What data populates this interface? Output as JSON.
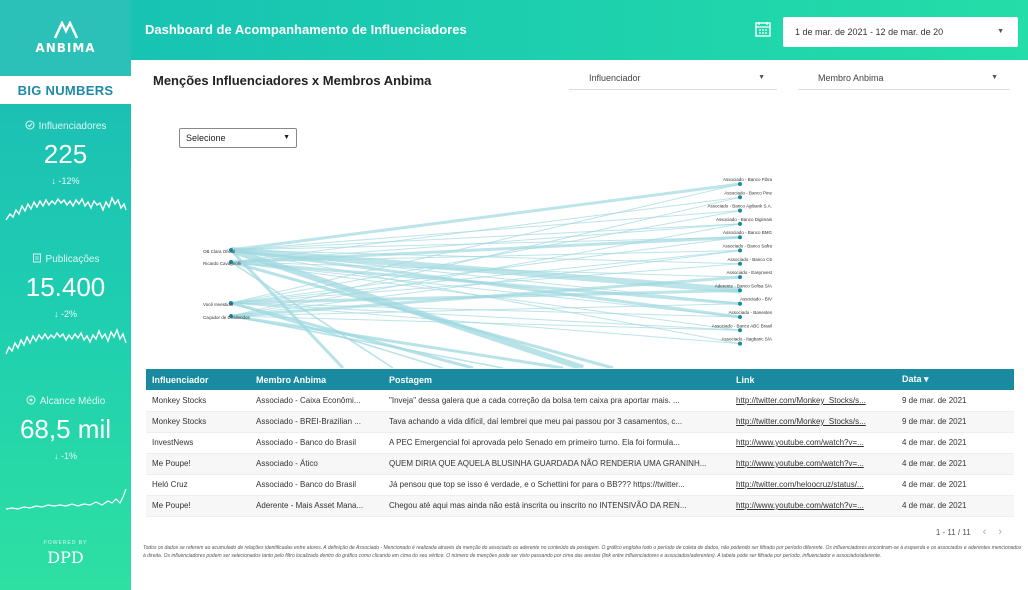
{
  "logo": {
    "text": "ANBIMA"
  },
  "sidebar": {
    "tab_label": "BIG NUMBERS",
    "metrics": [
      {
        "label": "Influenciadores",
        "value": "225",
        "delta": "-12%"
      },
      {
        "label": "Publicações",
        "value": "15.400",
        "delta": "-2%"
      },
      {
        "label": "Alcance Médio",
        "value": "68,5 mil",
        "delta": "-1%"
      }
    ],
    "powered_by": "POWERED BY",
    "powered_brand": "DPD"
  },
  "header": {
    "title": "Dashboard de Acompanhamento de Influenciadores",
    "date_range": "1 de mar. de 2021 - 12 de mar. de 20"
  },
  "main": {
    "title": "Menções Influenciadores x Membros Anbima",
    "filters": {
      "influenciador": "Influenciador",
      "membro": "Membro Anbima"
    },
    "select_placeholder": "Selecione"
  },
  "network": {
    "left_nodes": [
      "OB Clara Oficial",
      "Ricardo Cavagnolli",
      "Você Investidor",
      "Caçador de Dividendos"
    ],
    "right_nodes": [
      "Associado - Banco Fibra",
      "Associado - Banco Pine",
      "Associado - Banco Agibank S.A.",
      "Associado - Banco Digimais",
      "Associado - Banco BMG",
      "Associado - Banco Safra",
      "Associado - Banco C6",
      "Associado - Easynvest",
      "Aderente - Banco Sofisa S/A",
      "Associado - BIV",
      "Associado - Banestes",
      "Associado - Banco ABC Brasil",
      "Associado - Itagbanc S/A"
    ]
  },
  "table": {
    "columns": [
      "Influenciador",
      "Membro Anbima",
      "Postagem",
      "Link",
      "Data"
    ],
    "sort_indicator": "▾",
    "rows": [
      [
        "Monkey Stocks",
        "Associado - Caixa Econômi...",
        "\"Inveja\" dessa galera que a cada correção da bolsa tem caixa pra aportar mais. ...",
        "http://twitter.com/Monkey_Stocks/s...",
        "9 de mar. de 2021"
      ],
      [
        "Monkey Stocks",
        "Associado - BREI-Brazilian ...",
        "Tava achando a vida difícil, daí lembrei que meu pai passou por 3 casamentos, c...",
        "http://twitter.com/Monkey_Stocks/s...",
        "9 de mar. de 2021"
      ],
      [
        "InvestNews",
        "Associado - Banco do Brasil",
        "A PEC Emergencial foi aprovada pelo Senado em primeiro turno. Ela foi formula...",
        "http://www.youtube.com/watch?v=...",
        "4 de mar. de 2021"
      ],
      [
        "Me Poupe!",
        "Associado - Ático",
        "QUEM DIRIA QUE AQUELA BLUSINHA GUARDADA NÃO RENDERIA UMA GRANINH...",
        "http://www.youtube.com/watch?v=...",
        "4 de mar. de 2021"
      ],
      [
        "Heló Cruz",
        "Associado - Banco do Brasil",
        "Já pensou que top se isso é verdade, e o Schettini for para o BB??? https://twitter...",
        "http://twitter.com/heloocruz/status/...",
        "4 de mar. de 2021"
      ],
      [
        "Me Poupe!",
        "Aderente - Mais Asset Mana...",
        "Chegou até aqui mas ainda não está inscrita ou inscrito no INTENSIVÃO DA REN...",
        "http://www.youtube.com/watch?v=...",
        "4 de mar. de 2021"
      ]
    ],
    "pagination": "1 - 11 / 11"
  },
  "footnote": "Todos os dados se referem ao acumulado de relações identificadas entre atores. A definição de Associado - Mencionado é realizada através da menção do associado ou aderente no conteúdo da postagem. O gráfico engloba todo o período de coleta de dados, não podendo ser filtrado por período diferente. Os influenciadores encontram-se à esquerda e os associados e aderentes mencionados à direita. Os influenciadores podem ser selecionados tanto pelo filtro localizado dentro do gráfico como clicando em cima do seu vértice. O número de menções pode ser visto passando por cima das arestas (link entre influenciadores e associados/aderentes). A tabela pode ser filtrada por período, influenciador e associado/aderente.",
  "colors": {
    "accent": "#1a8aa0",
    "sidebar": "#1fcfb0",
    "edge": "#9fd8e0"
  }
}
